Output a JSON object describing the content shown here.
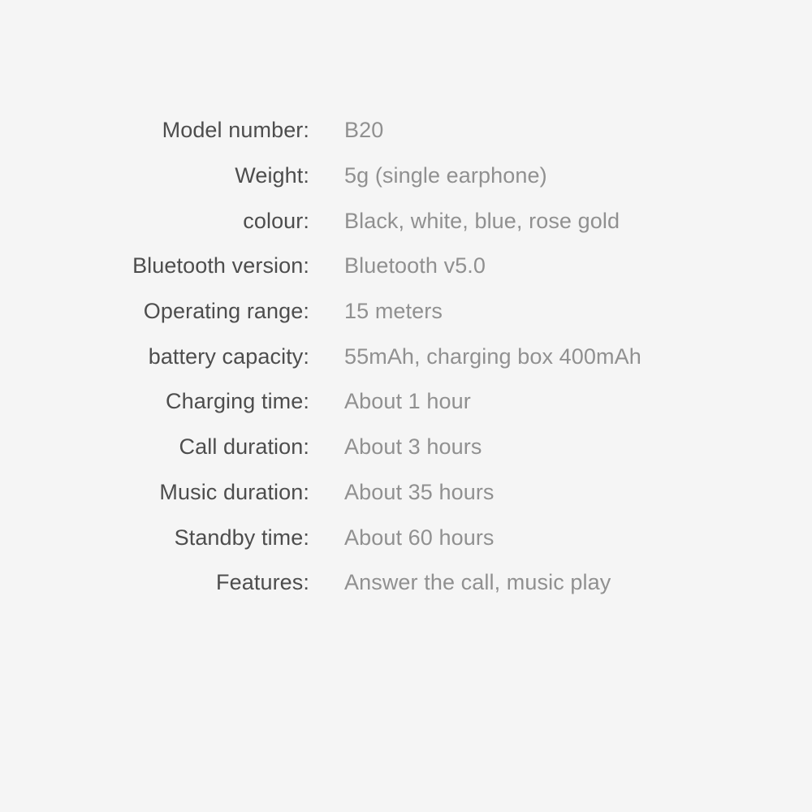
{
  "page": {
    "background_color": "#f5f5f5",
    "label_color": "#4d4d4d",
    "value_color": "#909090"
  },
  "spec_sheet": {
    "rows": [
      {
        "label": "Model number:",
        "value": "B20"
      },
      {
        "label": "Weight:",
        "value": "5g (single earphone)"
      },
      {
        "label": "colour:",
        "value": "Black, white, blue, rose gold"
      },
      {
        "label": "Bluetooth version:",
        "value": "Bluetooth v5.0"
      },
      {
        "label": "Operating range:",
        "value": "15 meters"
      },
      {
        "label": "battery capacity:",
        "value": "55mAh, charging box 400mAh"
      },
      {
        "label": "Charging time:",
        "value": "About 1 hour"
      },
      {
        "label": "Call duration:",
        "value": "About 3 hours"
      },
      {
        "label": "Music duration:",
        "value": "About 35 hours"
      },
      {
        "label": "Standby time:",
        "value": "About 60 hours"
      },
      {
        "label": "Features:",
        "value": "Answer the call, music play"
      }
    ]
  }
}
